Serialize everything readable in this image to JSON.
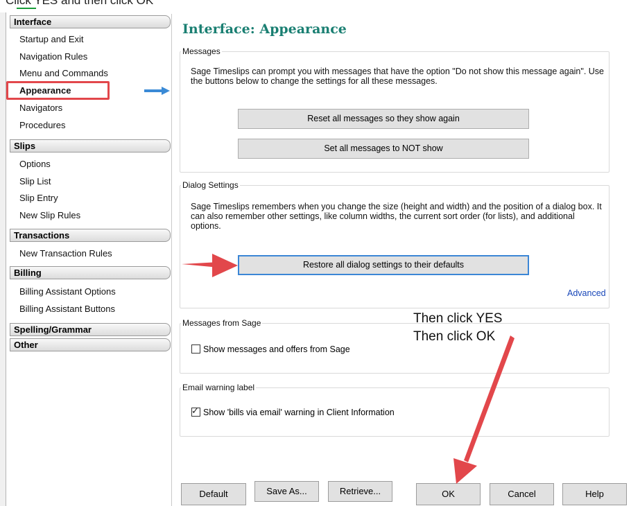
{
  "caption": "Click YES and then click OK",
  "sidebar": {
    "groups": [
      {
        "label": "Interface",
        "items": [
          "Startup and Exit",
          "Navigation Rules",
          "Menu and Commands",
          "Appearance",
          "Navigators",
          "Procedures"
        ]
      },
      {
        "label": "Slips",
        "items": [
          "Options",
          "Slip List",
          "Slip Entry",
          "New Slip Rules"
        ]
      },
      {
        "label": "Transactions",
        "items": [
          "New Transaction Rules"
        ]
      },
      {
        "label": "Billing",
        "items": [
          "Billing Assistant Options",
          "Billing Assistant Buttons"
        ]
      },
      {
        "label": "Spelling/Grammar",
        "items": []
      },
      {
        "label": "Other",
        "items": []
      }
    ],
    "active_item": "Appearance"
  },
  "main": {
    "title": "Interface: Appearance",
    "messages": {
      "legend": "Messages",
      "description": "Sage Timeslips can prompt you with messages that have the option \"Do not show this message again\". Use the buttons below to change the settings for all these messages.",
      "reset_button": "Reset all messages so they show again",
      "set_button": "Set all messages to NOT show"
    },
    "dialog_settings": {
      "legend": "Dialog Settings",
      "description": "Sage Timeslips remembers when you change the size (height and width) and the position of a dialog box. It can also remember other settings, like column widths, the current sort order (for lists), and additional options.",
      "restore_button": "Restore all dialog settings to their defaults",
      "advanced_link": "Advanced"
    },
    "messages_from_sage": {
      "legend": "Messages from Sage",
      "checkbox_label": "Show messages and offers from Sage",
      "checked": false
    },
    "email_warning": {
      "legend": "Email warning label",
      "checkbox_label": "Show 'bills via email' warning in Client Information",
      "checked": true
    }
  },
  "annotation": {
    "line1": "Then click YES",
    "line2": "Then click OK",
    "color": "#e2474b"
  },
  "footer": {
    "default": "Default",
    "save_as": "Save As...",
    "retrieve": "Retrieve...",
    "ok": "OK",
    "cancel": "Cancel",
    "help": "Help"
  },
  "colors": {
    "title": "#1a7f72",
    "link": "#1746b8",
    "highlight": "#e2474b",
    "arrow_blue": "#3a8ad6"
  }
}
